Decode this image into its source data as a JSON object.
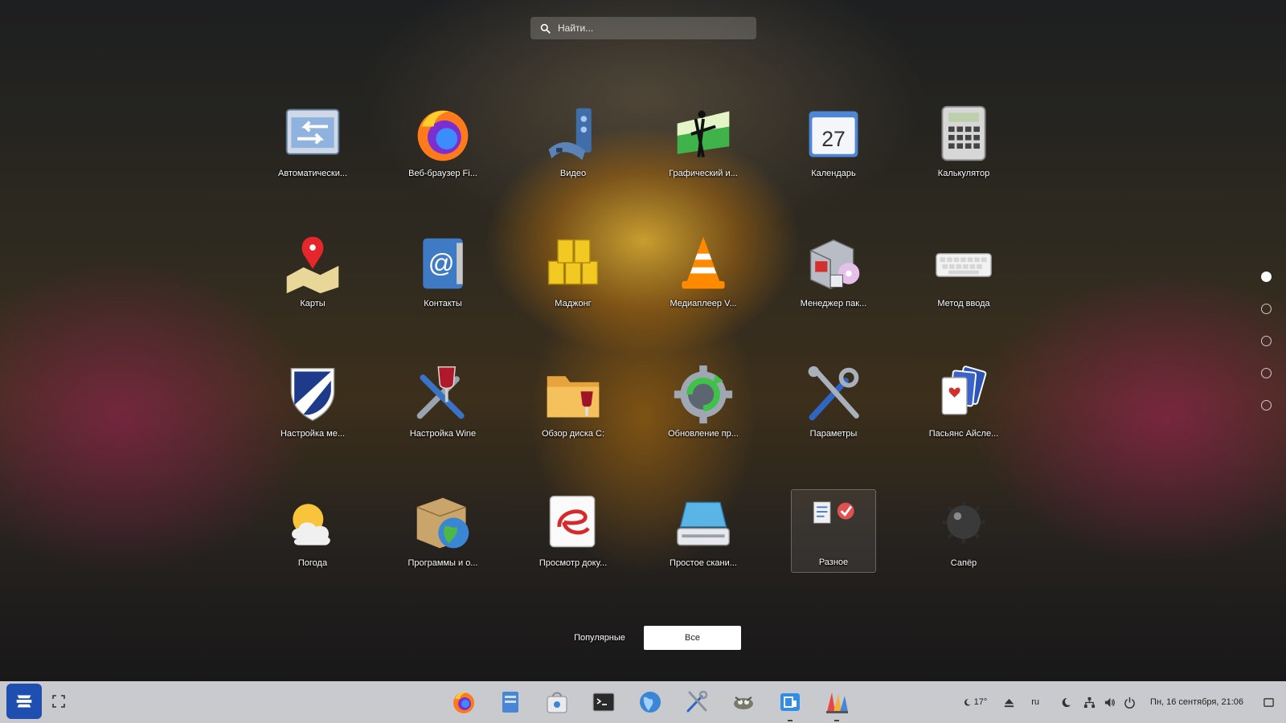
{
  "search": {
    "placeholder": "Найти..."
  },
  "apps": [
    {
      "label": "Автоматически...",
      "icon": "auto-login-icon"
    },
    {
      "label": "Веб-браузер Fi...",
      "icon": "firefox-icon"
    },
    {
      "label": "Видео",
      "icon": "video-icon"
    },
    {
      "label": "Графический и...",
      "icon": "graphics-app-icon"
    },
    {
      "label": "Календарь",
      "icon": "calendar-icon",
      "badge": "27"
    },
    {
      "label": "Калькулятор",
      "icon": "calculator-icon"
    },
    {
      "label": "Карты",
      "icon": "maps-icon"
    },
    {
      "label": "Контакты",
      "icon": "contacts-icon"
    },
    {
      "label": "Маджонг",
      "icon": "mahjong-icon"
    },
    {
      "label": "Медиаплеер V...",
      "icon": "vlc-icon"
    },
    {
      "label": "Менеджер пак...",
      "icon": "package-manager-icon"
    },
    {
      "label": "Метод ввода",
      "icon": "keyboard-icon"
    },
    {
      "label": "Настройка ме...",
      "icon": "shield-icon"
    },
    {
      "label": "Настройка Wine",
      "icon": "wine-config-icon"
    },
    {
      "label": "Обзор диска C:",
      "icon": "folder-wine-icon"
    },
    {
      "label": "Обновление пр...",
      "icon": "software-update-icon"
    },
    {
      "label": "Параметры",
      "icon": "settings-tools-icon"
    },
    {
      "label": "Пасьянс Айсле...",
      "icon": "cards-icon"
    },
    {
      "label": "Погода",
      "icon": "weather-icon"
    },
    {
      "label": "Программы и о...",
      "icon": "software-globe-icon"
    },
    {
      "label": "Просмотр доку...",
      "icon": "document-viewer-icon"
    },
    {
      "label": "Простое скани...",
      "icon": "scanner-icon"
    },
    {
      "label": "Разное",
      "icon": "folder-misc-icon"
    },
    {
      "label": "Сапёр",
      "icon": "mines-icon"
    }
  ],
  "categories": {
    "popular": "Популярные",
    "all": "Все",
    "active": "Все"
  },
  "pages": {
    "count": 5,
    "current": 1
  },
  "taskbar": {
    "apps": [
      "firefox-icon",
      "files-icon",
      "software-store-icon",
      "terminal-icon",
      "globe-icon",
      "settings-tools-icon",
      "zorin-appearance-icon",
      "zorin-connect-icon",
      "kolourpaint-icon"
    ],
    "weather": "17°",
    "keyboard_layout": "ru",
    "clock": "Пн, 16 сентября, 21:06"
  },
  "colors": {
    "taskbar_bg": "#e1e4e8",
    "zorin_blue": "#1e4fb0",
    "active_tab_bg": "#ffffff"
  }
}
